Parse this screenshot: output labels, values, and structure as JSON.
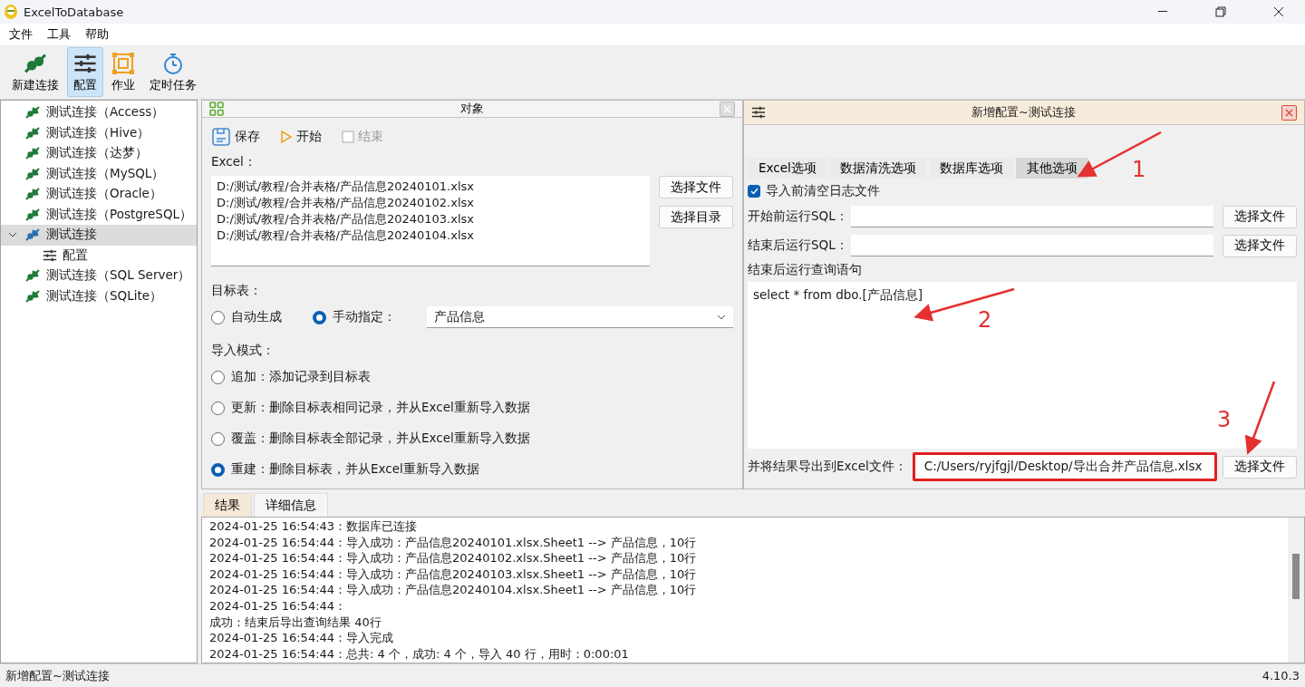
{
  "window": {
    "title": "ExcelToDatabase"
  },
  "menu": [
    {
      "label": "文件"
    },
    {
      "label": "工具"
    },
    {
      "label": "帮助"
    }
  ],
  "toolbar": [
    {
      "label": "新建连接",
      "kind": "connection",
      "selected": false
    },
    {
      "label": "配置",
      "kind": "config",
      "selected": true
    },
    {
      "label": "作业",
      "kind": "job",
      "selected": false
    },
    {
      "label": "定时任务",
      "kind": "timer",
      "selected": false
    }
  ],
  "tree": [
    {
      "label": "测试连接（Access）",
      "kind": "connection",
      "selected": false
    },
    {
      "label": "测试连接（Hive）",
      "kind": "connection",
      "selected": false
    },
    {
      "label": "测试连接（达梦）",
      "kind": "connection",
      "selected": false
    },
    {
      "label": "测试连接（MySQL）",
      "kind": "connection",
      "selected": false
    },
    {
      "label": "测试连接（Oracle）",
      "kind": "connection",
      "selected": false
    },
    {
      "label": "测试连接（PostgreSQL）",
      "kind": "connection",
      "selected": false
    },
    {
      "label": "测试连接",
      "kind": "connection",
      "selected": true,
      "expanded": true,
      "children": [
        {
          "label": "配置",
          "kind": "config",
          "selected": false
        }
      ]
    },
    {
      "label": "测试连接（SQL Server）",
      "kind": "connection",
      "selected": false
    },
    {
      "label": "测试连接（SQLite）",
      "kind": "connection",
      "selected": false
    }
  ],
  "object_panel": {
    "title": "对象",
    "actions": [
      {
        "label": "保存",
        "kind": "save",
        "disabled": false
      },
      {
        "label": "开始",
        "kind": "play",
        "disabled": false
      },
      {
        "label": "结束",
        "kind": "check",
        "disabled": true
      }
    ],
    "excel_label": "Excel：",
    "files": [
      "D:/测试/教程/合并表格/产品信息20240101.xlsx",
      "D:/测试/教程/合并表格/产品信息20240102.xlsx",
      "D:/测试/教程/合并表格/产品信息20240103.xlsx",
      "D:/测试/教程/合并表格/产品信息20240104.xlsx"
    ],
    "file_buttons": [
      "选择文件",
      "选择目录"
    ],
    "target_label": "目标表：",
    "target_options": [
      {
        "label": "自动生成",
        "selected": false
      },
      {
        "label": "手动指定：",
        "selected": true
      }
    ],
    "target_value": "产品信息",
    "mode_label": "导入模式：",
    "modes": [
      {
        "label": "追加：添加记录到目标表",
        "selected": false
      },
      {
        "label": "更新：删除目标表相同记录，并从Excel重新导入数据",
        "selected": false
      },
      {
        "label": "覆盖：删除目标表全部记录，并从Excel重新导入数据",
        "selected": false
      },
      {
        "label": "重建：删除目标表，并从Excel重新导入数据",
        "selected": true
      }
    ]
  },
  "config_panel": {
    "title": "新增配置~测试连接",
    "tabs": [
      {
        "label": "Excel选项",
        "selected": false
      },
      {
        "label": "数据清洗选项",
        "selected": false
      },
      {
        "label": "数据库选项",
        "selected": false
      },
      {
        "label": "其他选项",
        "selected": true
      }
    ],
    "clear_log": {
      "label": "导入前清空日志文件",
      "checked": true
    },
    "sql_fields": [
      {
        "label": "开始前运行SQL：",
        "button": "选择文件"
      },
      {
        "label": "结束后运行SQL：",
        "button": "选择文件"
      }
    ],
    "query_label": "结束后运行查询语句",
    "query": "select * from dbo.[产品信息]",
    "export": {
      "label": "并将结果导出到Excel文件：",
      "value": "C:/Users/ryjfgjl/Desktop/导出合并产品信息.xlsx",
      "button": "选择文件",
      "highlighted": true
    }
  },
  "annotations": [
    {
      "label": "1"
    },
    {
      "label": "2"
    },
    {
      "label": "3"
    }
  ],
  "log": {
    "tabs": [
      {
        "label": "结果",
        "selected": true
      },
      {
        "label": "详细信息",
        "selected": false
      }
    ],
    "lines": [
      "2024-01-25 16:54:43：数据库已连接",
      "2024-01-25 16:54:44：导入成功：产品信息20240101.xlsx.Sheet1 --> 产品信息，10行",
      "2024-01-25 16:54:44：导入成功：产品信息20240102.xlsx.Sheet1 --> 产品信息，10行",
      "2024-01-25 16:54:44：导入成功：产品信息20240103.xlsx.Sheet1 --> 产品信息，10行",
      "2024-01-25 16:54:44：导入成功：产品信息20240104.xlsx.Sheet1 --> 产品信息，10行",
      "2024-01-25 16:54:44：",
      "成功：结束后导出查询结果 40行",
      "2024-01-25 16:54:44：导入完成",
      "2024-01-25 16:54:44：总共: 4 个，成功: 4 个，导入 40 行，用时：0:00:01"
    ]
  },
  "status_bar": {
    "text": "新增配置~测试连接",
    "version": "4.10.3"
  }
}
